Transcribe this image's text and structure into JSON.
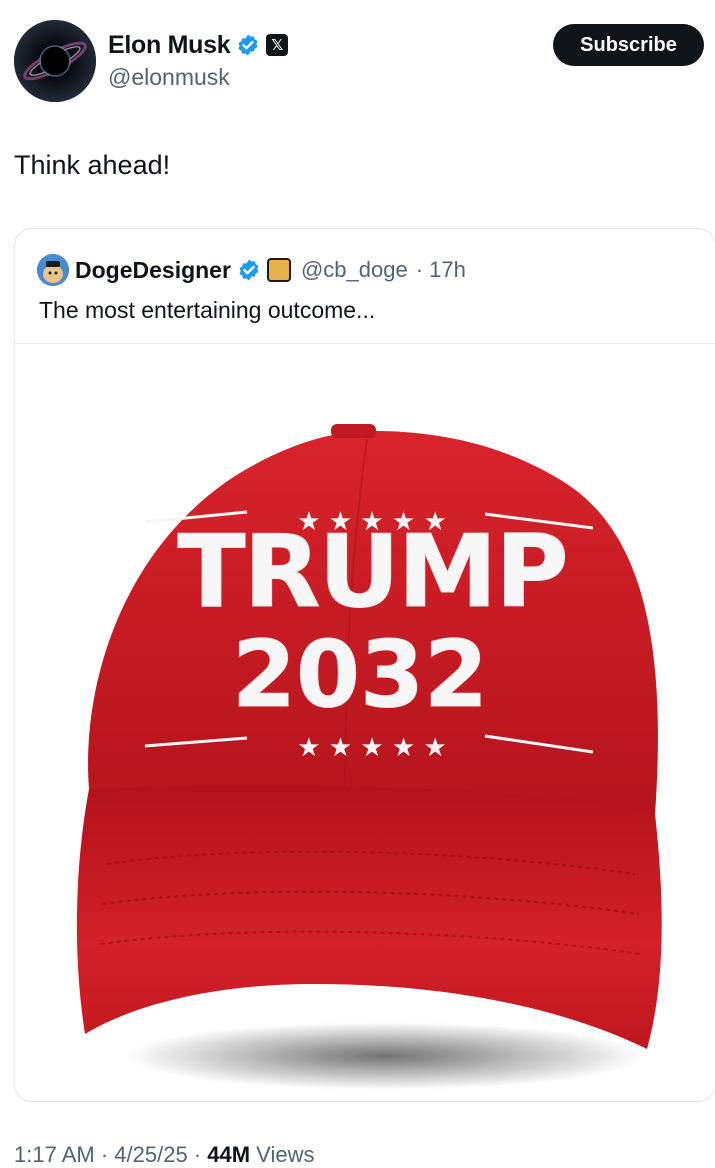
{
  "post": {
    "author_name": "Elon Musk",
    "author_handle": "@elonmusk",
    "x_badge": "𝕏",
    "subscribe_label": "Subscribe",
    "text": "Think ahead!",
    "time": "1:17 AM",
    "date": "4/25/25",
    "separator": " · ",
    "views_count": "44M",
    "views_label": "Views"
  },
  "quoted": {
    "author_name": "DogeDesigner",
    "author_handle": "@cb_doge",
    "age": "· 17h",
    "text": "The most entertaining outcome...",
    "image": {
      "line1": "TRUMP",
      "line2": "2032",
      "stars_top": "★ ★ ★ ★ ★",
      "stars_bottom": "★ ★ ★ ★ ★"
    }
  },
  "colors": {
    "verified_blue": "#1d9bf0",
    "cap_red": "#d4222a",
    "text_primary": "#0f1419",
    "text_secondary": "#536471"
  },
  "icons": {
    "verified": "verified-badge-icon",
    "x_logo": "x-logo-icon",
    "doge_affiliate": "doge-affiliate-icon"
  }
}
